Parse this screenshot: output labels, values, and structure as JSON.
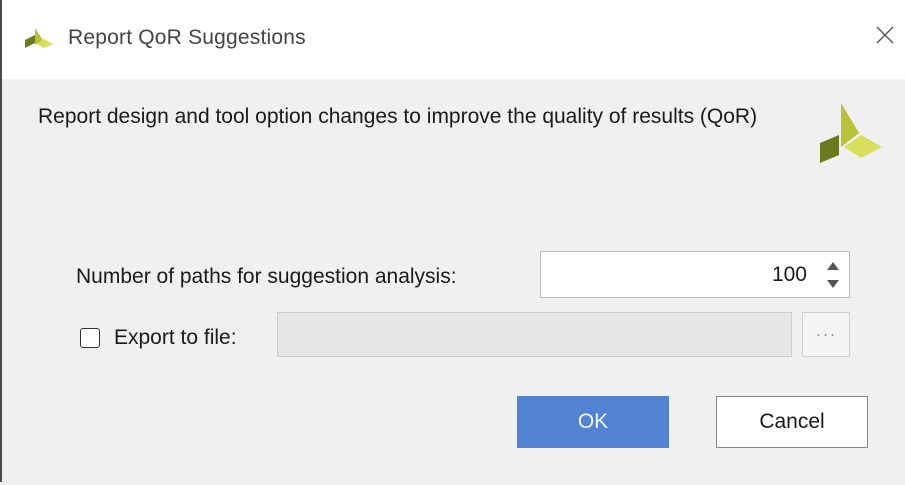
{
  "window": {
    "title": "Report QoR Suggestions",
    "close_icon": "close-icon",
    "logo_icon": "xilinx-logo-icon"
  },
  "main": {
    "description": "Report design and tool option changes to improve the quality of results (QoR)",
    "brand_icon": "xilinx-logo-icon"
  },
  "form": {
    "paths_label": "Number of paths for suggestion analysis:",
    "paths_value": "100",
    "export_checked": false,
    "export_label": "Export to file:",
    "export_path": "",
    "browse_label": "···"
  },
  "buttons": {
    "ok": "OK",
    "cancel": "Cancel"
  },
  "colors": {
    "ok_background": "#5282d2",
    "content_background": "#f0f0f0",
    "logo_dark": "#6b7a1f",
    "logo_light": "#d3dc4a"
  }
}
